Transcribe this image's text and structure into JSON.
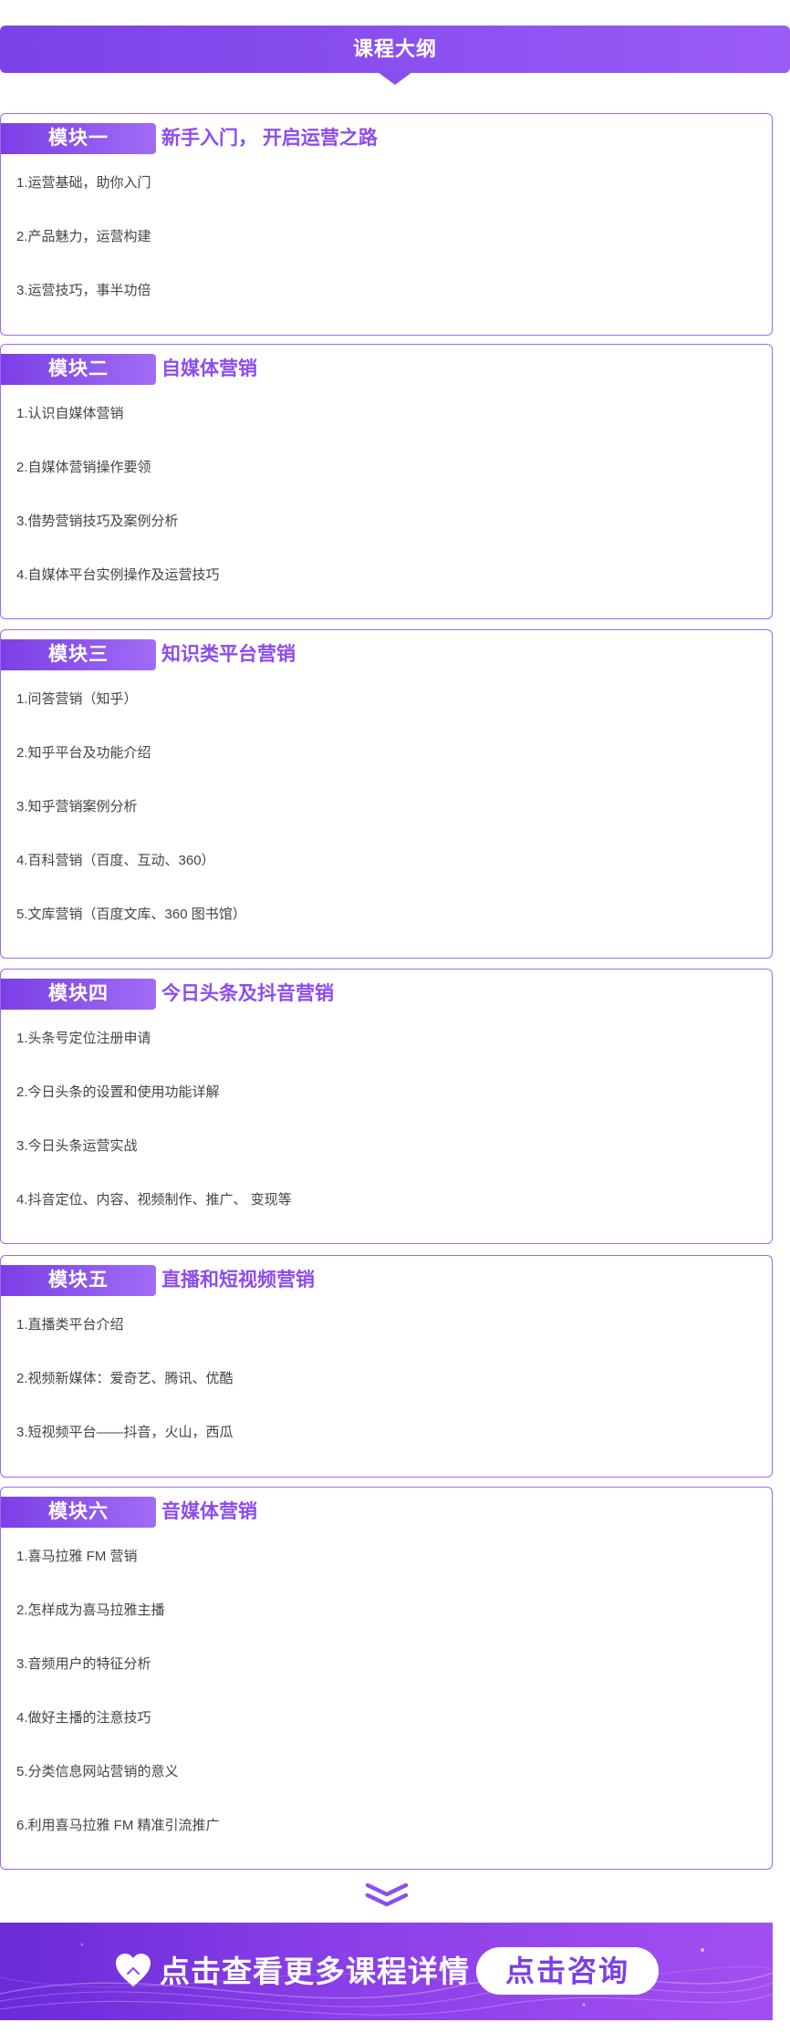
{
  "header": {
    "title": "课程大纲"
  },
  "modules": [
    {
      "tag": "模块一",
      "heading": "新手入门， 开启运营之路",
      "items": [
        "1.运营基础，助你入门",
        "2.产品魅力，运营构建",
        "3.运营技巧，事半功倍"
      ]
    },
    {
      "tag": "模块二",
      "heading": "自媒体营销",
      "items": [
        "1.认识自媒体营销",
        "2.自媒体营销操作要领",
        "3.借势营销技巧及案例分析",
        "4.自媒体平台实例操作及运营技巧"
      ]
    },
    {
      "tag": "模块三",
      "heading": "知识类平台营销",
      "items": [
        "1.问答营销（知乎）",
        "2.知乎平台及功能介绍",
        "3.知乎营销案例分析",
        "4.百科营销（百度、互动、360）",
        "5.文库营销（百度文库、360 图书馆）"
      ]
    },
    {
      "tag": "模块四",
      "heading": "今日头条及抖音营销",
      "items": [
        "1.头条号定位注册申请",
        "2.今日头条的设置和使用功能详解",
        "3.今日头条运营实战",
        "4.抖音定位、内容、视频制作、推广、 变现等"
      ]
    },
    {
      "tag": "模块五",
      "heading": "直播和短视频营销",
      "items": [
        "1.直播类平台介绍",
        "2.视频新媒体：爱奇艺、腾讯、优酷",
        "3.短视频平台——抖音，火山，西瓜"
      ]
    },
    {
      "tag": "模块六",
      "heading": "音媒体营销",
      "items": [
        "1.喜马拉雅 FM 营销",
        "2.怎样成为喜马拉雅主播",
        "3.音频用户的特征分析",
        "4.做好主播的注意技巧",
        "5.分类信息网站营销的意义",
        "6.利用喜马拉雅 FM 精准引流推广"
      ]
    }
  ],
  "more": {
    "icon": "double-chevron-down-icon"
  },
  "cta": {
    "heart_icon": "heart-icon",
    "text": "点击查看更多课程详情",
    "button_label": "点击咨询"
  },
  "colors": {
    "accent": "#8d4cf0",
    "accent_dark": "#7b42e8",
    "border": "#9b6bf2",
    "item_text": "#444444"
  }
}
